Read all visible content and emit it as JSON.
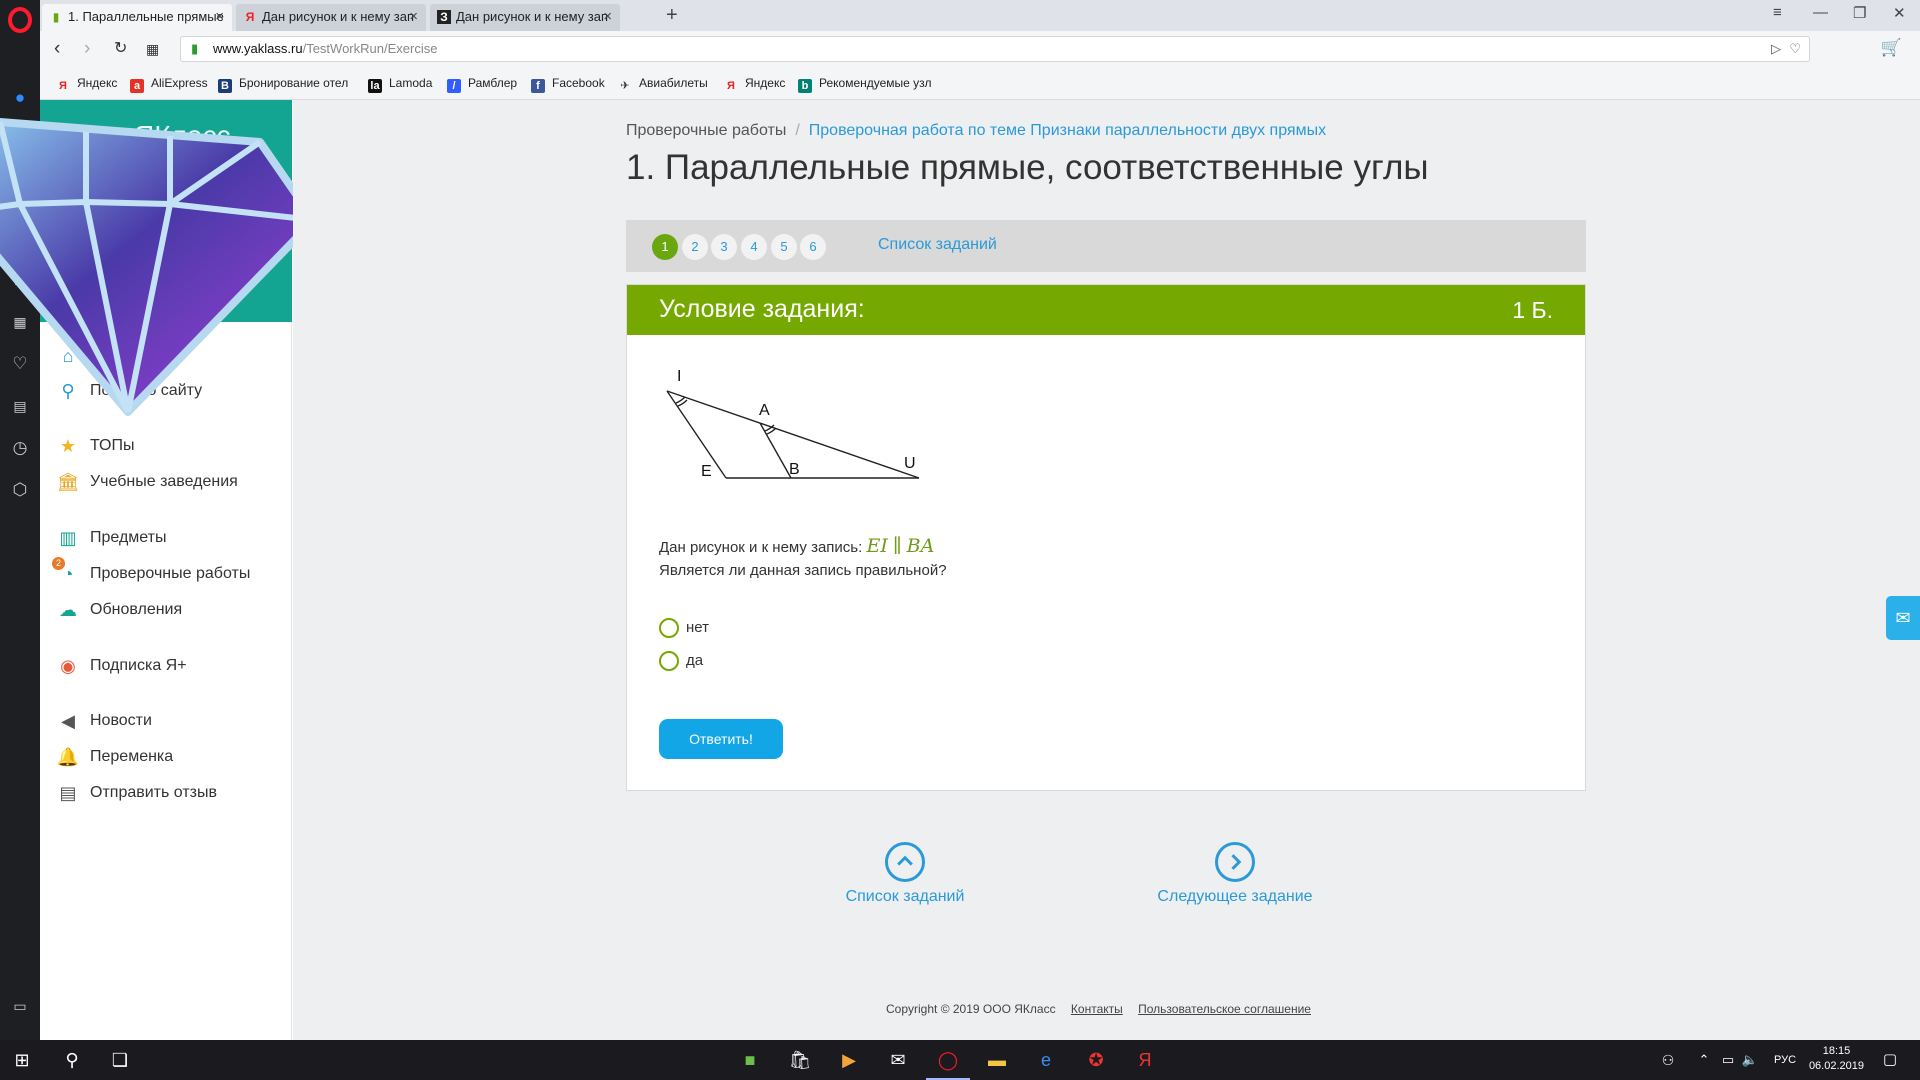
{
  "browser": {
    "tabs": [
      {
        "label": "1. Параллельные прямые",
        "favicon": "yaklass-icon",
        "active": true
      },
      {
        "label": "Дан рисунок и к нему зап",
        "favicon": "yandex-icon",
        "active": false
      },
      {
        "label": "Дан рисунок и к нему зап",
        "favicon": "znanija-icon",
        "active": false
      }
    ],
    "url_host": "www.yaklass.ru",
    "url_path": "/TestWorkRun/Exercise",
    "bookmarks": [
      {
        "label": "Яндекс",
        "icon": "yandex-icon",
        "color": "#e22"
      },
      {
        "label": "AliExpress",
        "icon": "aliexpress-icon",
        "color": "#e43225"
      },
      {
        "label": "Бронирование отел",
        "icon": "booking-icon",
        "color": "#1c3b79"
      },
      {
        "label": "Lamoda",
        "icon": "lamoda-icon",
        "color": "#111"
      },
      {
        "label": "Рамблер",
        "icon": "rambler-icon",
        "color": "#315efb"
      },
      {
        "label": "Facebook",
        "icon": "facebook-icon",
        "color": "#3b5998"
      },
      {
        "label": "Авиабилеты",
        "icon": "plane-icon",
        "color": "#333"
      },
      {
        "label": "Яндекс",
        "icon": "yandex-icon",
        "color": "#e22"
      },
      {
        "label": "Рекомендуемые узл",
        "icon": "bing-icon",
        "color": "#008373"
      }
    ]
  },
  "site": {
    "logo_text": "ЯКласс",
    "menu": [
      {
        "label": "Главная",
        "icon": "home-icon"
      },
      {
        "label": "Поиск по сайту",
        "icon": "search-icon"
      },
      {
        "label": "ТОПы",
        "icon": "star-icon"
      },
      {
        "label": "Учебные заведения",
        "icon": "school-icon"
      },
      {
        "label": "Предметы",
        "icon": "books-icon"
      },
      {
        "label": "Проверочные работы",
        "icon": "check-icon",
        "badge": "2"
      },
      {
        "label": "Обновления",
        "icon": "cloud-icon"
      },
      {
        "label": "Подписка Я+",
        "icon": "subscription-icon"
      },
      {
        "label": "Новости",
        "icon": "megaphone-icon"
      },
      {
        "label": "Переменка",
        "icon": "bell-icon"
      },
      {
        "label": "Отправить отзыв",
        "icon": "feedback-icon"
      }
    ]
  },
  "main": {
    "breadcrumb": [
      "Проверочные работы",
      "Проверочная работа по теме Признаки параллельности двух прямых"
    ],
    "title": "1. Параллельные прямые, соответственные углы",
    "task_numbers": [
      "1",
      "2",
      "3",
      "4",
      "5",
      "6"
    ],
    "current_task": "1",
    "task_list_label": "Список заданий",
    "task_header": "Условие задания:",
    "points": "1 Б.",
    "figure_labels": {
      "I": "I",
      "A": "A",
      "E": "E",
      "B": "B",
      "U": "U"
    },
    "question_line1": "Дан рисунок и к нему запись:",
    "formula_left": "EI",
    "formula_sym": "∥",
    "formula_right": "BA",
    "question_line2": "Является ли данная запись правильной?",
    "options": [
      "нет",
      "да"
    ],
    "answer_button": "Ответить!",
    "nav_list": "Список заданий",
    "nav_next": "Следующее задание",
    "footer_copyright": "Copyright © 2019 ООО ЯКласс",
    "footer_contacts": "Контакты",
    "footer_agreement": "Пользовательское соглашение"
  },
  "taskbar": {
    "lang": "РУС",
    "time": "18:15",
    "date": "06.02.2019"
  },
  "colors": {
    "green": "#75a800",
    "link": "#2a9ad8",
    "teal": "#14a492",
    "button": "#12a6e6"
  }
}
